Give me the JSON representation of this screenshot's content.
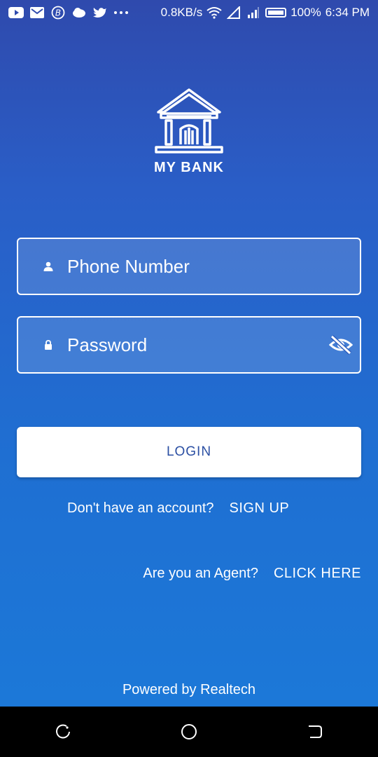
{
  "status_bar": {
    "network_speed": "0.8KB/s",
    "battery": "100%",
    "time": "6:34 PM",
    "icons": [
      "youtube-icon",
      "gmail-icon",
      "bitcoin-icon",
      "cloud-icon",
      "twitter-icon",
      "more-dots-icon",
      "wifi-icon",
      "signal-icon",
      "battery-icon"
    ]
  },
  "logo": {
    "text": "MY BANK",
    "icon": "bank-icon"
  },
  "phone": {
    "placeholder": "Phone Number",
    "icon": "person-icon"
  },
  "password": {
    "placeholder": "Password",
    "icon": "lock-icon",
    "toggle_icon": "eye-off-icon"
  },
  "login": {
    "label": "LOGIN"
  },
  "signup": {
    "prompt": "Don't have an account?",
    "link": "SIGN UP"
  },
  "agent": {
    "prompt": "Are you an Agent?",
    "link": "CLICK HERE"
  },
  "footer": {
    "powered_by": "Powered by Realtech"
  },
  "nav_bar": {
    "icons": [
      "recent-apps-icon",
      "home-icon",
      "back-icon"
    ]
  },
  "colors": {
    "gradient_top": "#2f4aad",
    "gradient_bottom": "#1b7ad9",
    "button_text": "#2b4fa3"
  }
}
